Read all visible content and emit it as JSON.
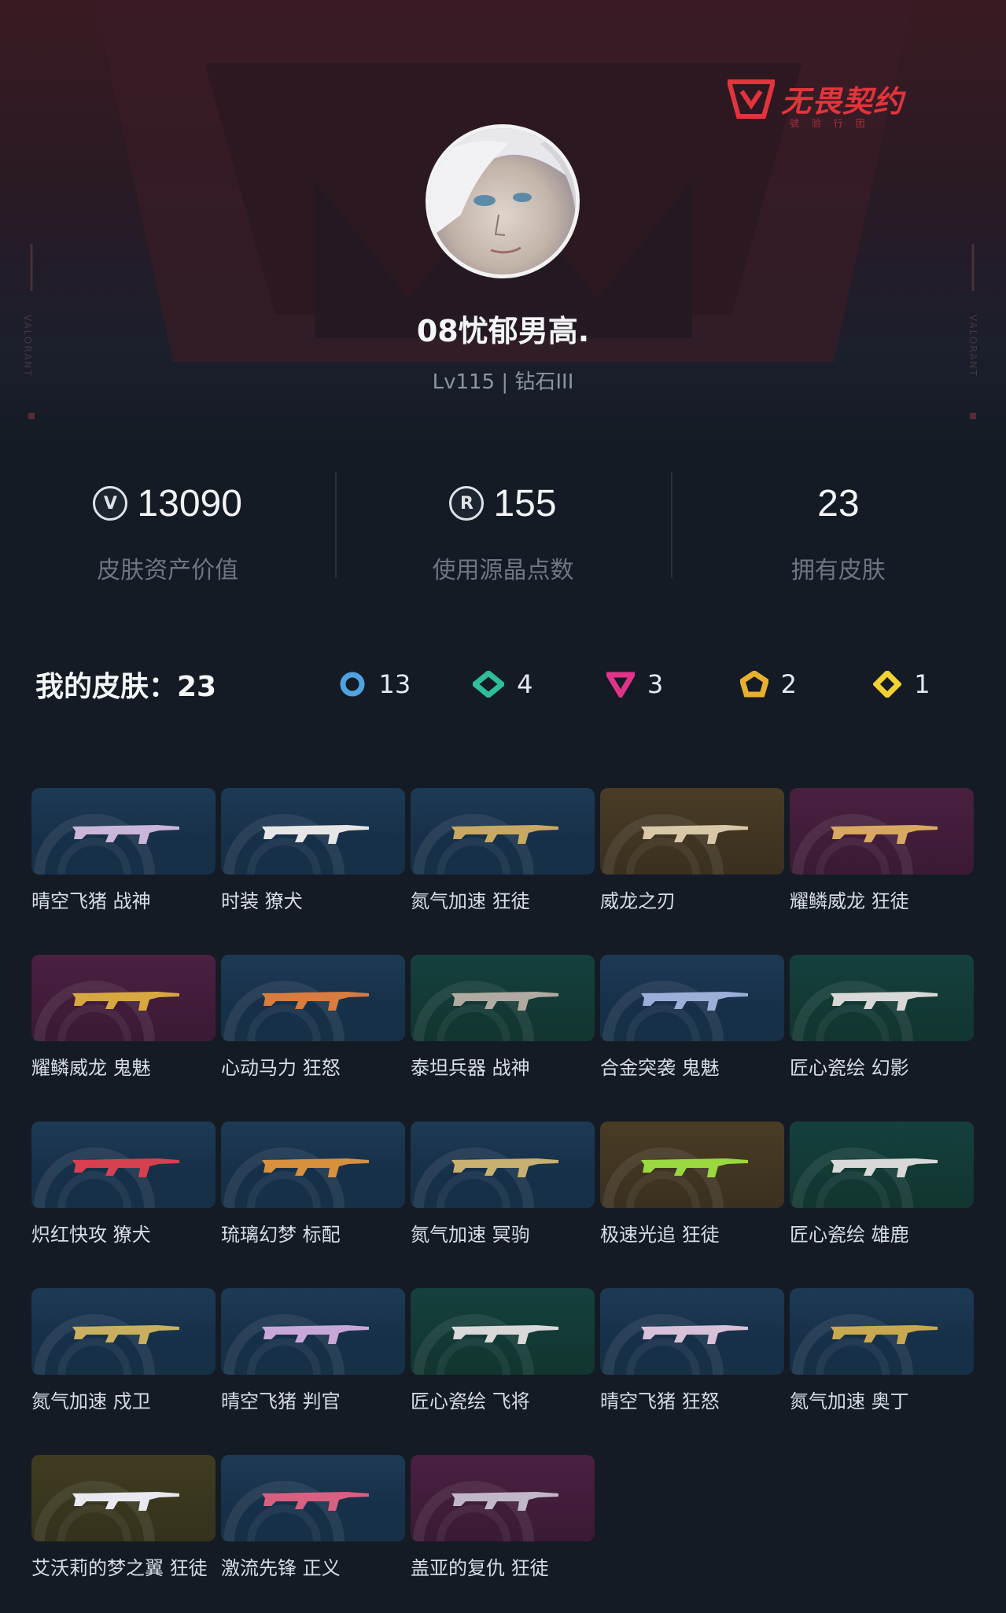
{
  "brand": {
    "name": "无畏契约",
    "sub": "號 验 行 团",
    "side_label": "VALORANT"
  },
  "profile": {
    "username": "08忧郁男高.",
    "level_text": "Lv115 | 钻石III"
  },
  "stats": [
    {
      "icon": "valorant-points-icon",
      "value": "13090",
      "label": "皮肤资产价值"
    },
    {
      "icon": "radianite-icon",
      "value": "155",
      "label": "使用源晶点数"
    },
    {
      "icon": "",
      "value": "23",
      "label": "拥有皮肤"
    }
  ],
  "skins": {
    "title": "我的皮肤：23",
    "tiers": [
      {
        "icon": "select-tier-icon",
        "color": "#4fa3e0",
        "count": "13"
      },
      {
        "icon": "deluxe-tier-icon",
        "color": "#2fbf98",
        "count": "4"
      },
      {
        "icon": "premium-tier-icon",
        "color": "#e0348a",
        "count": "3"
      },
      {
        "icon": "ultra-tier-icon",
        "color": "#e8b030",
        "count": "2"
      },
      {
        "icon": "exclusive-tier-icon",
        "color": "#f2d232",
        "count": "1"
      }
    ],
    "items": [
      {
        "name": "晴空飞猪 战神",
        "bg": "blue",
        "gun": "#c9b6d8"
      },
      {
        "name": "时装 獠犬",
        "bg": "blue",
        "gun": "#e6e6e6"
      },
      {
        "name": "氮气加速 狂徒",
        "bg": "blue",
        "gun": "#c8a964"
      },
      {
        "name": "威龙之刃",
        "bg": "gold",
        "gun": "#d8c8a8"
      },
      {
        "name": "耀鳞威龙 狂徒",
        "bg": "purple",
        "gun": "#d8a860"
      },
      {
        "name": "耀鳞威龙 鬼魅",
        "bg": "purple",
        "gun": "#d8a840"
      },
      {
        "name": "心动马力 狂怒",
        "bg": "blue",
        "gun": "#d87c40"
      },
      {
        "name": "泰坦兵器 战神",
        "bg": "teal",
        "gun": "#b0aaa0"
      },
      {
        "name": "合金突袭 鬼魅",
        "bg": "blue",
        "gun": "#9ab0d8"
      },
      {
        "name": "匠心瓷绘 幻影",
        "bg": "teal",
        "gun": "#d8d8d8"
      },
      {
        "name": "炽红快攻 獠犬",
        "bg": "blue",
        "gun": "#d84050"
      },
      {
        "name": "琉璃幻梦 标配",
        "bg": "blue",
        "gun": "#d8903c"
      },
      {
        "name": "氮气加速 冥驹",
        "bg": "blue",
        "gun": "#c8b070"
      },
      {
        "name": "极速光追 狂徒",
        "bg": "gold",
        "gun": "#9ad840"
      },
      {
        "name": "匠心瓷绘 雄鹿",
        "bg": "teal",
        "gun": "#d8d8d8"
      },
      {
        "name": "氮气加速 戍卫",
        "bg": "blue",
        "gun": "#c8b060"
      },
      {
        "name": "晴空飞猪 判官",
        "bg": "blue",
        "gun": "#c8a8d8"
      },
      {
        "name": "匠心瓷绘 飞将",
        "bg": "teal",
        "gun": "#d8d8d8"
      },
      {
        "name": "晴空飞猪 狂怒",
        "bg": "blue",
        "gun": "#d8c0d8"
      },
      {
        "name": "氮气加速 奥丁",
        "bg": "blue",
        "gun": "#c8a850"
      },
      {
        "name": "艾沃莉的梦之翼 狂徒",
        "bg": "olive",
        "gun": "#e8e8f0"
      },
      {
        "name": "激流先锋 正义",
        "bg": "blue",
        "gun": "#d86080"
      },
      {
        "name": "盖亚的复仇 狂徒",
        "bg": "purple",
        "gun": "#c0b8c8"
      }
    ]
  }
}
